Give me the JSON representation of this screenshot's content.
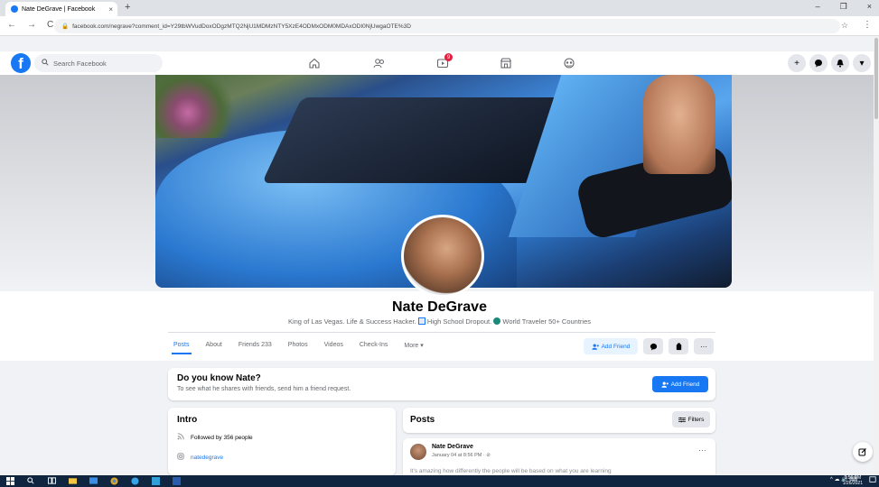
{
  "browser": {
    "tab_title": "Nate DeGrave | Facebook",
    "tab_close": "×",
    "new_tab": "+",
    "url": "facebook.com/negrave?comment_id=Y29tbWVudDoxODgzMTQ2NjU1MDMzNTY5XzE4ODMxODM0MDAxODI0NjUwgaOTE%3D",
    "back": "←",
    "forward": "→",
    "reload": "C",
    "lock": "🔒",
    "star": "☆",
    "menu": "⋮",
    "minimize": "–",
    "maximize": "❐",
    "close": "×"
  },
  "fb": {
    "logo": "f",
    "search_placeholder": "Search Facebook",
    "watch_badge": "9",
    "right_buttons": [
      "+",
      "💬",
      "🔔",
      "▾"
    ]
  },
  "profile": {
    "name": "Nate DeGrave",
    "bio_part1": "King of Las Vegas. Life & Success Hacker.",
    "bio_part2": "High School Dropout.",
    "bio_part3": "World Traveler 50+ Countries",
    "tabs": [
      "Posts",
      "About",
      "Friends 233",
      "Photos",
      "Videos",
      "Check-Ins",
      "More ▾"
    ],
    "add_friend": "Add Friend",
    "more_dots": "···"
  },
  "know": {
    "title": "Do you know Nate?",
    "subtitle": "To see what he shares with friends, send him a friend request.",
    "button": "Add Friend"
  },
  "intro": {
    "title": "Intro",
    "followed": "Followed by 356 people",
    "instagram": "natedegrave"
  },
  "posts": {
    "title": "Posts",
    "filters": "Filters",
    "post_author": "Nate DeGrave",
    "post_time": "January 04 at 8:56 PM · ⊘",
    "post_more": "···",
    "post_text": "It's amazing how differently the people will be based on what you are learning"
  },
  "taskbar": {
    "time": "3:56 PM",
    "date": "1/26/2021",
    "tray": "^ ☁ 🔊 ⌨"
  },
  "colors": {
    "facebook_blue": "#1877f2",
    "taskbar": "#10253f"
  }
}
